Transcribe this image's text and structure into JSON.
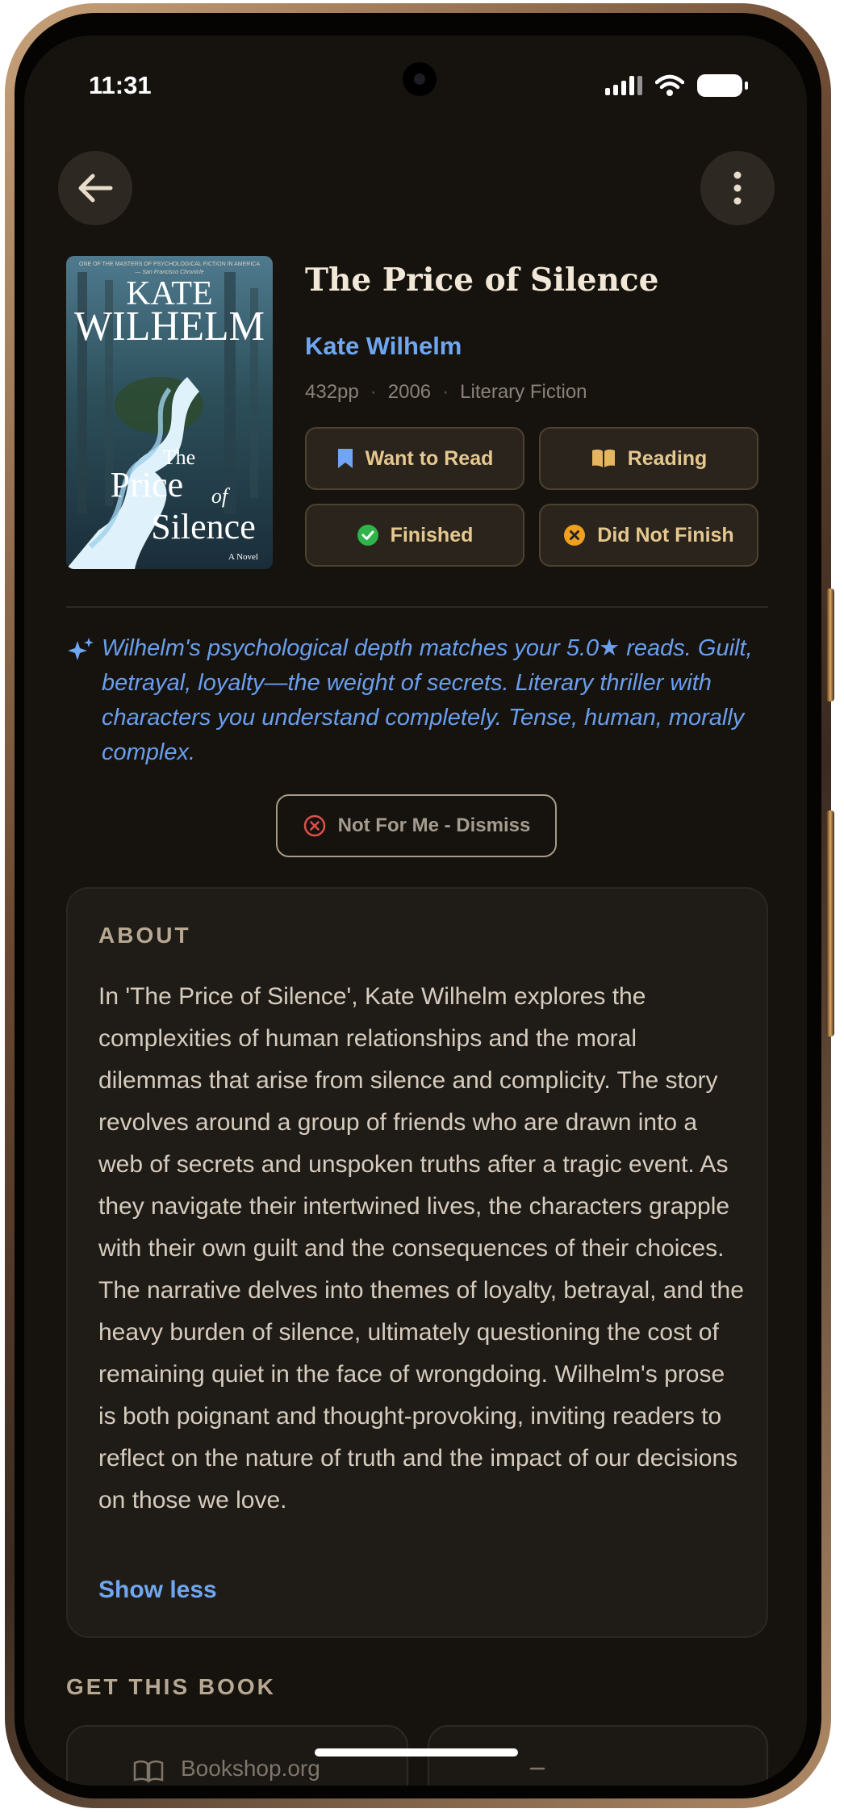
{
  "status_bar": {
    "time": "11:31"
  },
  "book": {
    "title": "The Price of Silence",
    "author": "Kate Wilhelm",
    "pages": "432pp",
    "year": "2006",
    "genre": "Literary Fiction",
    "cover": {
      "tagline": "ONE OF THE MASTERS OF PSYCHOLOGICAL FICTION IN AMERICA",
      "quote_source": "— San Francisco Chronicle",
      "author_first": "KATE",
      "author_last": "WILHELM",
      "title_line1": "The",
      "title_line2": "Price",
      "title_line3": "of",
      "title_line4": "Silence",
      "subtitle": "A Novel"
    }
  },
  "actions": {
    "want_to_read": "Want to Read",
    "reading": "Reading",
    "finished": "Finished",
    "did_not_finish": "Did Not Finish"
  },
  "recommendation": {
    "text": "Wilhelm's psychological depth matches your 5.0★ reads. Guilt, betrayal, loyalty—the weight of secrets. Literary thriller with characters you understand completely. Tense, human, morally complex.",
    "dismiss_label": "Not For Me - Dismiss"
  },
  "about": {
    "heading": "ABOUT",
    "body": "In 'The Price of Silence', Kate Wilhelm explores the complexities of human relationships and the moral dilemmas that arise from silence and complicity. The story revolves around a group of friends who are drawn into a web of secrets and unspoken truths after a tragic event. As they navigate their intertwined lives, the characters grapple with their own guilt and the consequences of their choices. The narrative delves into themes of loyalty, betrayal, and the heavy burden of silence, ultimately questioning the cost of remaining quiet in the face of wrongdoing. Wilhelm's prose is both poignant and thought-provoking, inviting readers to reflect on the nature of truth and the impact of our decisions on those we love.",
    "show_less": "Show less"
  },
  "get_book": {
    "heading": "GET THIS BOOK",
    "stores": [
      "Bookshop.org"
    ]
  },
  "icons": {
    "back": "arrow-left-icon",
    "menu": "more-vertical-icon",
    "want": "bookmark-icon",
    "reading": "open-book-icon",
    "finished": "check-circle-icon",
    "dnf": "x-circle-icon",
    "sparkle": "sparkle-icon",
    "dismiss": "x-circle-icon"
  },
  "colors": {
    "background": "#16130f",
    "accent_blue": "#6ea6f2",
    "accent_gold": "#e6c88f",
    "finished_green": "#2fb34a",
    "dnf_orange": "#f0a020",
    "dismiss_red": "#e0504a"
  }
}
